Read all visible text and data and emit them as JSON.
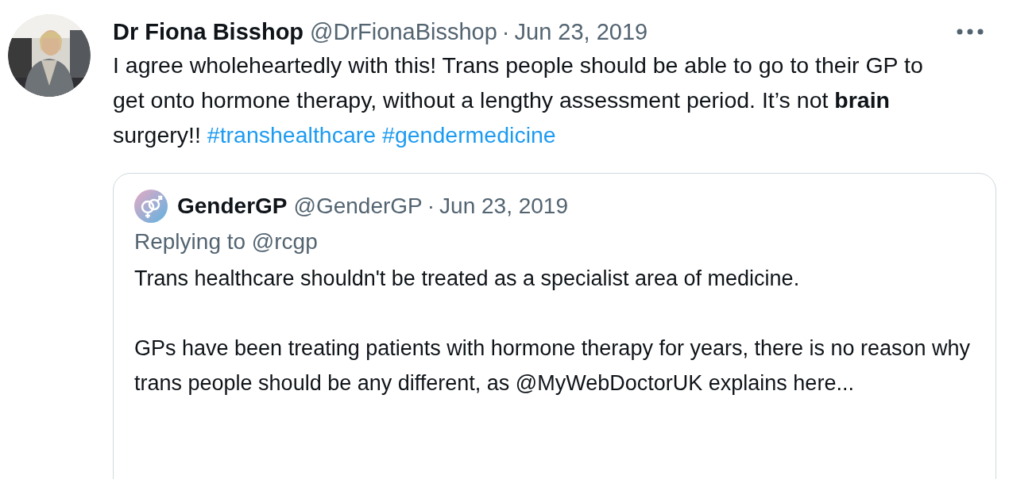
{
  "tweet": {
    "author": "Dr Fiona Bisshop",
    "handle": "@DrFionaBisshop",
    "separator": "·",
    "date": "Jun 23, 2019",
    "body": "I agree wholeheartedly with this! Trans people should be able to go to their GP to get onto hormone therapy, without a lengthy assessment period. It’s not **brain** surgery!!",
    "hashtags": [
      "#transhealthcare",
      "#gendermedicine"
    ]
  },
  "quoted": {
    "author": "GenderGP",
    "handle": "@GenderGP",
    "separator": "·",
    "date": "Jun 23, 2019",
    "replying_to": "Replying to @rcgp",
    "paragraphs": [
      "Trans healthcare shouldn't be treated as a specialist area of medicine.",
      "GPs have been treating patients with hormone therapy for years, there is no reason why trans people should be any different, as @MyWebDoctorUK explains here..."
    ]
  }
}
